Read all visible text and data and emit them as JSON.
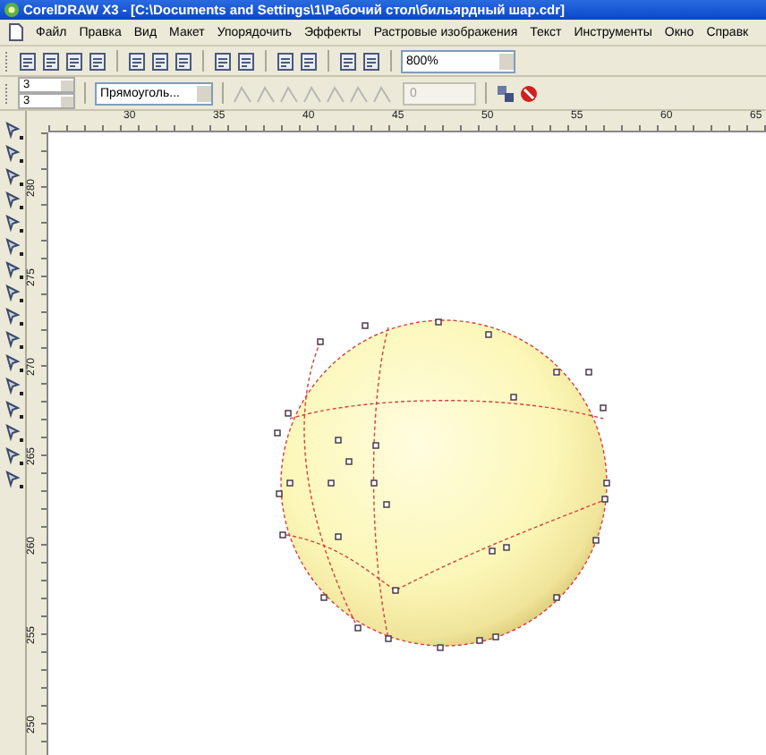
{
  "window": {
    "title": "CorelDRAW X3 - [C:\\Documents and Settings\\1\\Рабочий стол\\бильярдный шар.cdr]"
  },
  "menu": [
    "Файл",
    "Правка",
    "Вид",
    "Макет",
    "Упорядочить",
    "Эффекты",
    "Растровые изображения",
    "Текст",
    "Инструменты",
    "Окно",
    "Справк"
  ],
  "standard_toolbar": {
    "zoom": "800%"
  },
  "property_bar": {
    "columns": "3",
    "rows": "3",
    "shape": "Прямоуголь...",
    "value": "0"
  },
  "ruler_h": [
    "30",
    "35",
    "40",
    "45",
    "50",
    "55",
    "60",
    "65"
  ],
  "ruler_v": [
    "280",
    "275",
    "270",
    "265",
    "260",
    "255",
    "250"
  ]
}
